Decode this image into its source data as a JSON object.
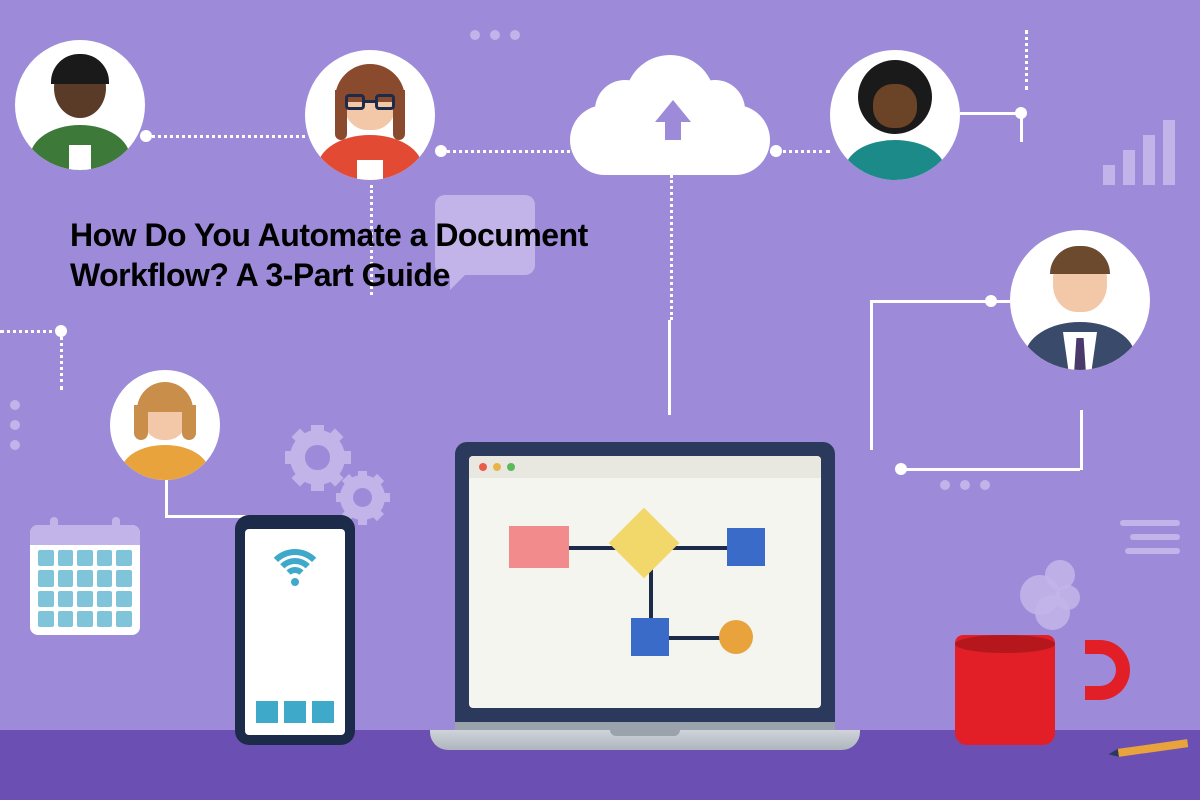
{
  "title": "How Do You Automate a Document Workflow? A 3-Part Guide",
  "colors": {
    "background": "#9d8bd9",
    "desk": "#6b4fb3",
    "accent_light": "#c2b4e8",
    "laptop_shell": "#2b3a5c",
    "mug": "#e21f26",
    "cyan": "#3fa9c9"
  },
  "avatars": [
    {
      "id": "person-1",
      "skin": "#5a3b28",
      "hair": "#1a1a1a",
      "top": "#3d7a3a"
    },
    {
      "id": "person-2",
      "skin": "#f2c8a8",
      "hair": "#8a4a2e",
      "top": "#e24a33",
      "glasses": true
    },
    {
      "id": "person-3",
      "skin": "#6b4327",
      "hair": "#1a1a1a",
      "top": "#1d8a8a"
    },
    {
      "id": "person-4",
      "skin": "#f2c8a8",
      "hair": "#6b4a2e",
      "top": "#3a4a6b",
      "tie": "#4a3a6b"
    },
    {
      "id": "person-5",
      "skin": "#f2c8a8",
      "hair": "#c98f4a",
      "top": "#e8a33d"
    }
  ],
  "laptop": {
    "window_dots": [
      "#e85c4a",
      "#e8b54a",
      "#5cb85c"
    ],
    "flowchart_shapes": [
      "rect-pink",
      "diamond-yellow",
      "rect-blue",
      "rect-blue-small",
      "circle-orange"
    ]
  },
  "phone": {
    "app_count": 3
  },
  "barchart": {
    "bars": [
      20,
      35,
      50,
      65
    ]
  },
  "icons": [
    "cloud-upload",
    "calendar",
    "gear",
    "gear",
    "bar-chart",
    "speech-bubble",
    "wifi",
    "coffee-mug",
    "pencil",
    "speed-lines"
  ]
}
